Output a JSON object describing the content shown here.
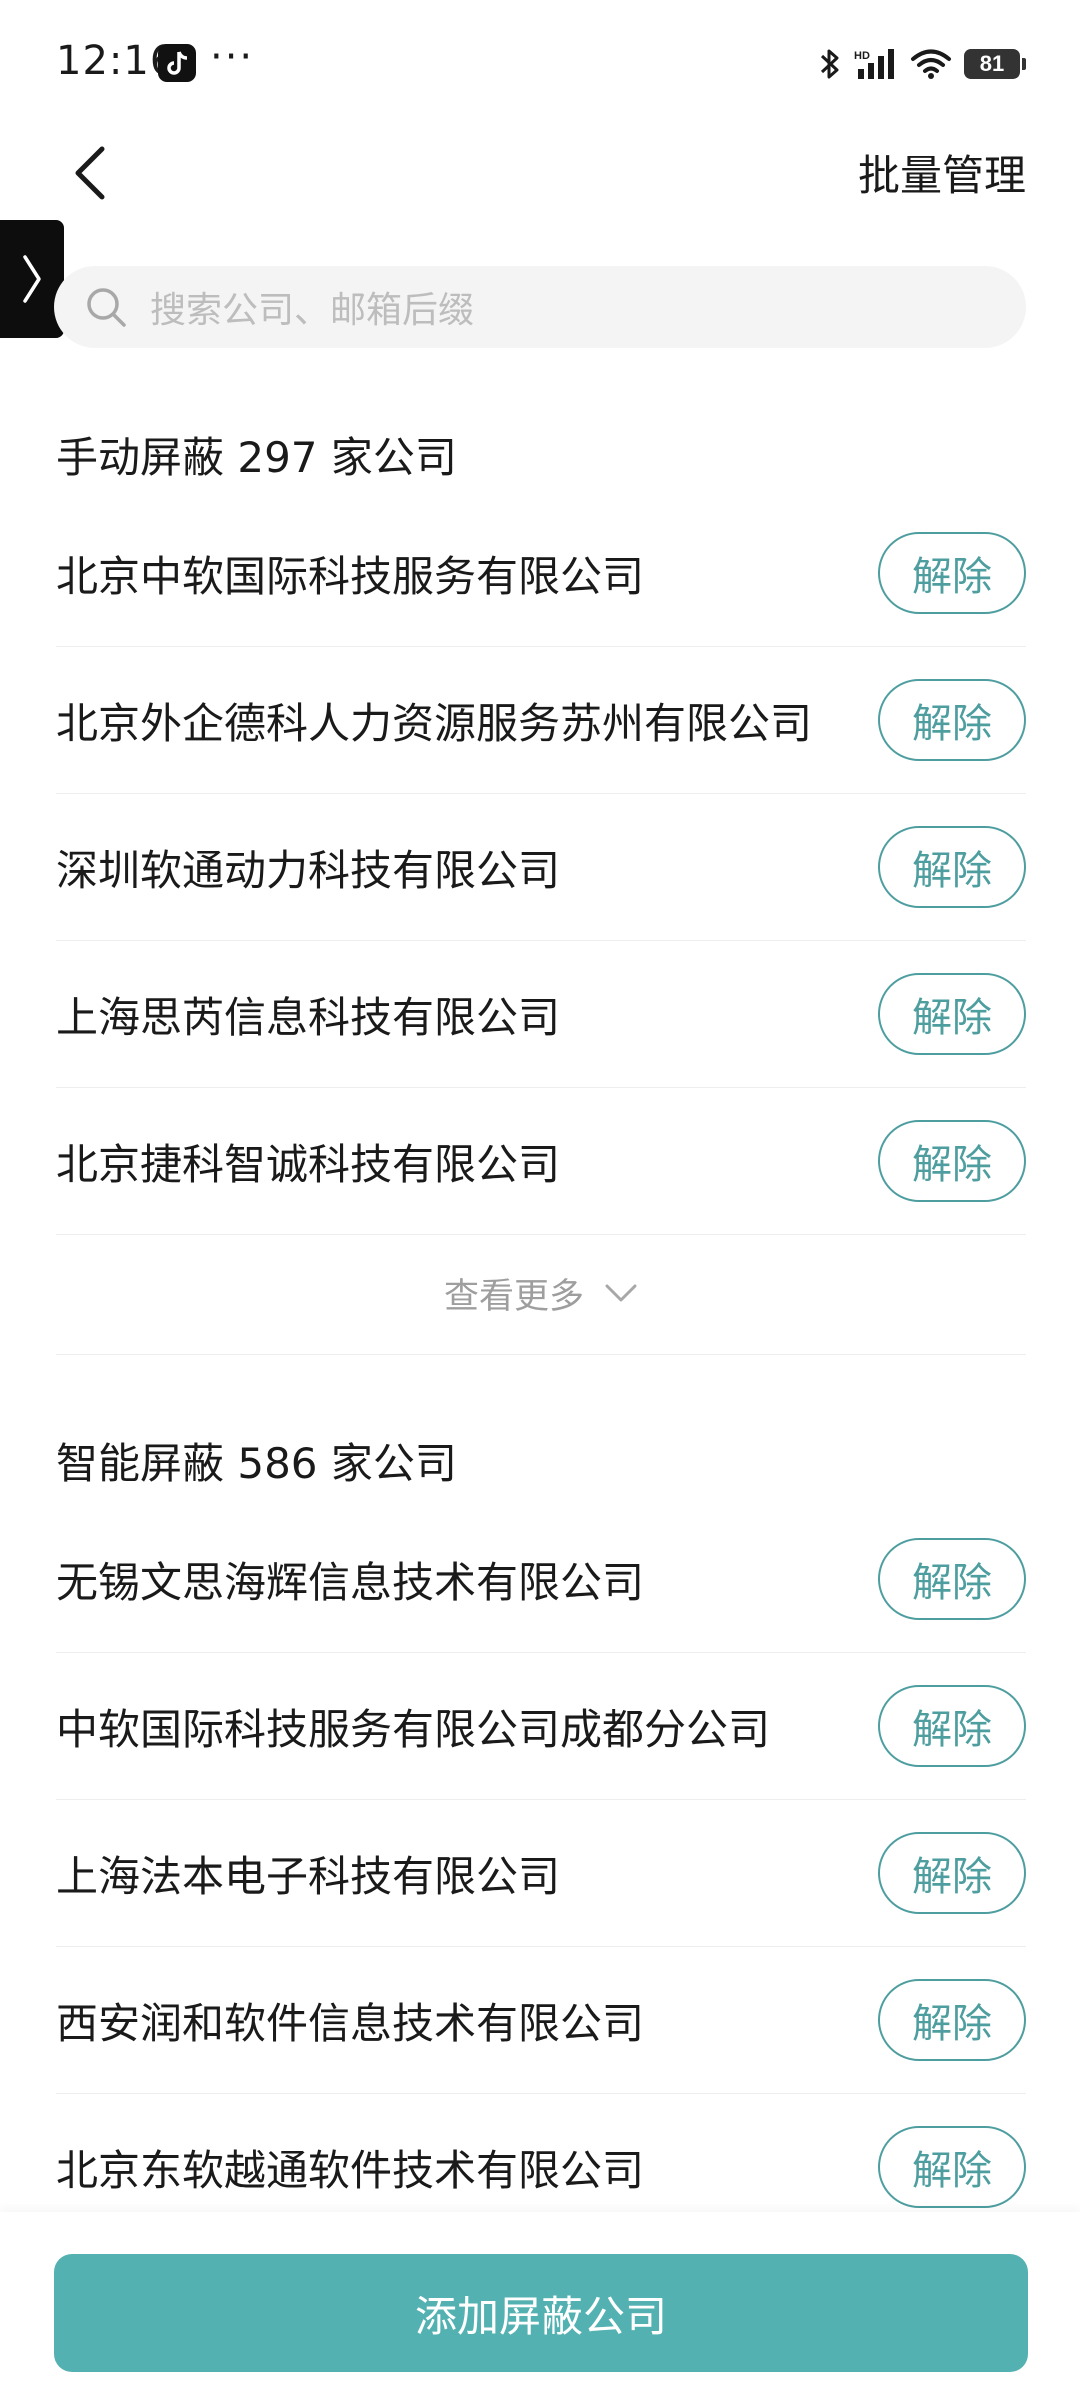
{
  "status_bar": {
    "time": "12:16",
    "dots": "···",
    "battery": "81"
  },
  "header": {
    "action_label": "批量管理"
  },
  "search": {
    "placeholder": "搜索公司、邮箱后缀"
  },
  "manual_section": {
    "title": "手动屏蔽 297 家公司",
    "items": [
      {
        "name": "北京中软国际科技服务有限公司",
        "action": "解除"
      },
      {
        "name": "北京外企德科人力资源服务苏州有限公司",
        "action": "解除"
      },
      {
        "name": "深圳软通动力科技有限公司",
        "action": "解除"
      },
      {
        "name": "上海思芮信息科技有限公司",
        "action": "解除"
      },
      {
        "name": "北京捷科智诚科技有限公司",
        "action": "解除"
      }
    ],
    "more_label": "查看更多"
  },
  "smart_section": {
    "title": "智能屏蔽 586 家公司",
    "items": [
      {
        "name": "无锡文思海辉信息技术有限公司",
        "action": "解除"
      },
      {
        "name": "中软国际科技服务有限公司成都分公司",
        "action": "解除"
      },
      {
        "name": "上海法本电子科技有限公司",
        "action": "解除"
      },
      {
        "name": "西安润和软件信息技术有限公司",
        "action": "解除"
      },
      {
        "name": "北京东软越通软件技术有限公司",
        "action": "解除"
      }
    ]
  },
  "bottom": {
    "add_label": "添加屏蔽公司"
  },
  "colors": {
    "accent": "#4e9ea0",
    "primary_button": "#54b1b2"
  }
}
